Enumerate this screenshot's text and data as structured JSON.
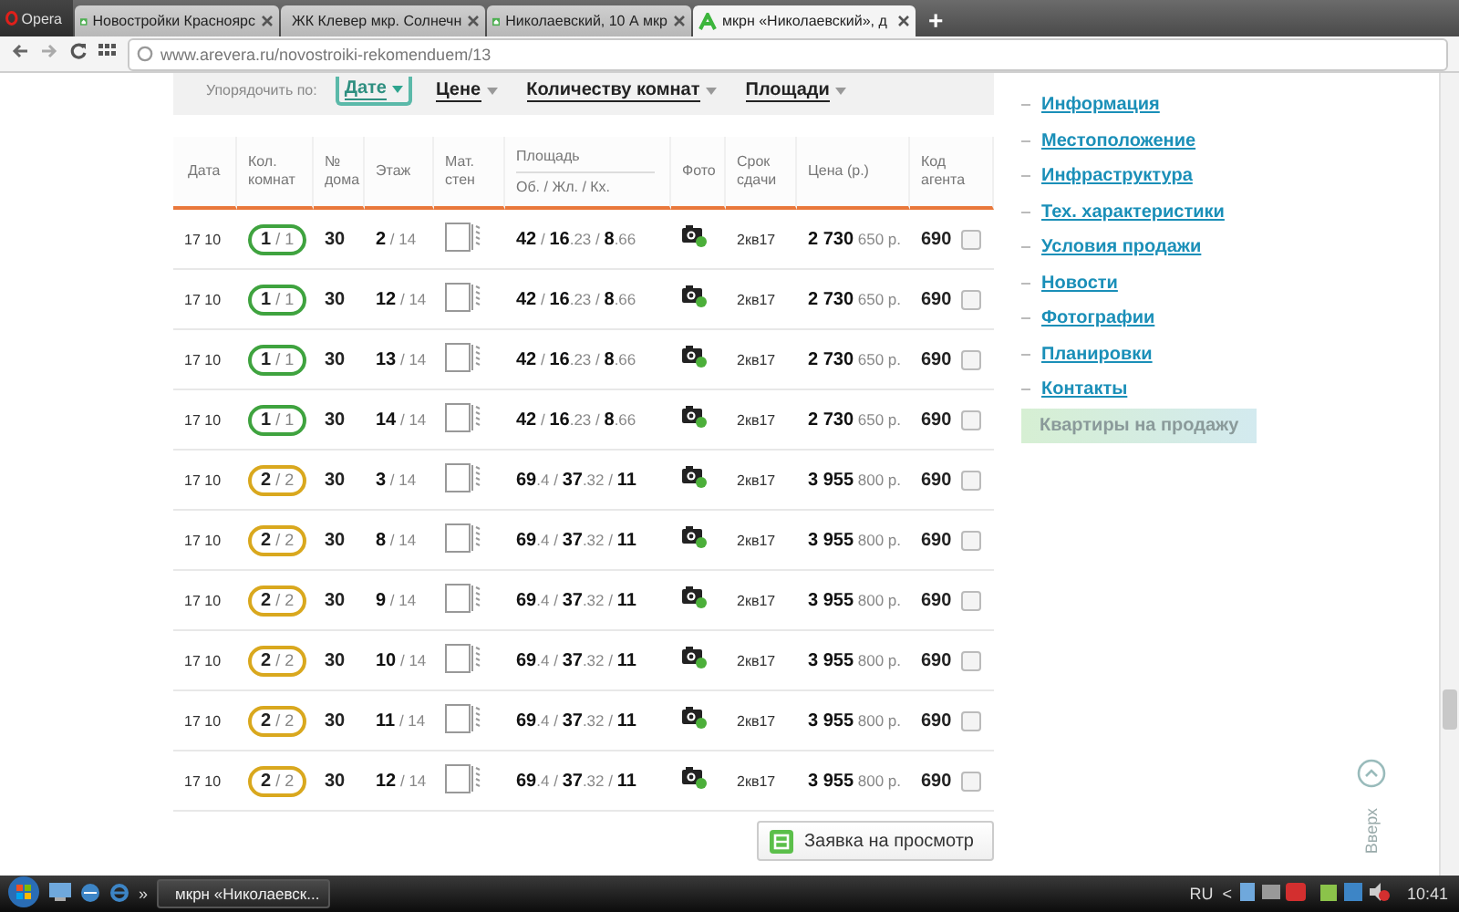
{
  "browser": {
    "menu_label": "Opera",
    "tabs": [
      {
        "title": "Новостройки Красноярс",
        "selected": false
      },
      {
        "title": "ЖК Клевер мкр. Солнечн",
        "selected": false
      },
      {
        "title": "Николаевский, 10 А мкр",
        "selected": false
      },
      {
        "title": "мкрн «Николаевский», д",
        "selected": true
      }
    ],
    "new_tab": "+",
    "url": "www.arevera.ru/novostroiki-rekomenduem/13"
  },
  "sort_bar": {
    "label": "Упорядочить по:",
    "options": [
      {
        "label": "Дате",
        "selected": true
      },
      {
        "label": "Цене",
        "selected": false
      },
      {
        "label": "Количеству комнат",
        "selected": false
      },
      {
        "label": "Площади",
        "selected": false
      }
    ]
  },
  "table": {
    "columns": [
      {
        "label": "Дата"
      },
      {
        "label": "Кол. комнат"
      },
      {
        "label": "№ дома"
      },
      {
        "label": "Этаж"
      },
      {
        "label": "Мат. стен"
      },
      {
        "label": "Площадь",
        "sublabel": "Об. / Жл. / Кх."
      },
      {
        "label": "Фото"
      },
      {
        "label": "Срок сдачи"
      },
      {
        "label": "Цена (р.)"
      },
      {
        "label": "Код агента"
      }
    ],
    "rows": [
      {
        "date": "17 10",
        "rooms": "**1** / 1",
        "color": "#3fa33f",
        "house": "30",
        "floor": "**2** / 14",
        "area": "**42** / **16**.23 / **8**.66",
        "term": "2кв17",
        "price": "**2 730** 650 р.",
        "agent": "690",
        "checked": false
      },
      {
        "date": "17 10",
        "rooms": "**1** / 1",
        "color": "#3fa33f",
        "house": "30",
        "floor": "**12** / 14",
        "area": "**42** / **16**.23 / **8**.66",
        "term": "2кв17",
        "price": "**2 730** 650 р.",
        "agent": "690",
        "checked": false
      },
      {
        "date": "17 10",
        "rooms": "**1** / 1",
        "color": "#3fa33f",
        "house": "30",
        "floor": "**13** / 14",
        "area": "**42** / **16**.23 / **8**.66",
        "term": "2кв17",
        "price": "**2 730** 650 р.",
        "agent": "690",
        "checked": false
      },
      {
        "date": "17 10",
        "rooms": "**1** / 1",
        "color": "#3fa33f",
        "house": "30",
        "floor": "**14** / 14",
        "area": "**42** / **16**.23 / **8**.66",
        "term": "2кв17",
        "price": "**2 730** 650 р.",
        "agent": "690",
        "checked": false
      },
      {
        "date": "17 10",
        "rooms": "**2** / 2",
        "color": "#d9a81e",
        "house": "30",
        "floor": "**3** / 14",
        "area": "**69**.4 / **37**.32 / **11**",
        "term": "2кв17",
        "price": "**3 955** 800 р.",
        "agent": "690",
        "checked": false
      },
      {
        "date": "17 10",
        "rooms": "**2** / 2",
        "color": "#d9a81e",
        "house": "30",
        "floor": "**8** / 14",
        "area": "**69**.4 / **37**.32 / **11**",
        "term": "2кв17",
        "price": "**3 955** 800 р.",
        "agent": "690",
        "checked": false
      },
      {
        "date": "17 10",
        "rooms": "**2** / 2",
        "color": "#d9a81e",
        "house": "30",
        "floor": "**9** / 14",
        "area": "**69**.4 / **37**.32 / **11**",
        "term": "2кв17",
        "price": "**3 955** 800 р.",
        "agent": "690",
        "checked": false
      },
      {
        "date": "17 10",
        "rooms": "**2** / 2",
        "color": "#d9a81e",
        "house": "30",
        "floor": "**10** / 14",
        "area": "**69**.4 / **37**.32 / **11**",
        "term": "2кв17",
        "price": "**3 955** 800 р.",
        "agent": "690",
        "checked": false
      },
      {
        "date": "17 10",
        "rooms": "**2** / 2",
        "color": "#d9a81e",
        "house": "30",
        "floor": "**11** / 14",
        "area": "**69**.4 / **37**.32 / **11**",
        "term": "2кв17",
        "price": "**3 955** 800 р.",
        "agent": "690",
        "checked": false
      },
      {
        "date": "17 10",
        "rooms": "**2** / 2",
        "color": "#d9a81e",
        "house": "30",
        "floor": "**12** / 14",
        "area": "**69**.4 / **37**.32 / **11**",
        "term": "2кв17",
        "price": "**3 955** 800 р.",
        "agent": "690",
        "checked": false
      }
    ]
  },
  "request_button": "Заявка на просмотр",
  "sidebar": {
    "items": [
      {
        "label": "Информация",
        "selected": false
      },
      {
        "label": "Местоположение",
        "selected": false
      },
      {
        "label": "Инфраструктура",
        "selected": false
      },
      {
        "label": "Тех. характеристики",
        "selected": false
      },
      {
        "label": "Условия продажи",
        "selected": false
      },
      {
        "label": "Новости",
        "selected": false
      },
      {
        "label": "Фотографии",
        "selected": false
      },
      {
        "label": "Планировки",
        "selected": false
      },
      {
        "label": "Контакты",
        "selected": false
      },
      {
        "label": "Квартиры на продажу",
        "selected": true
      }
    ]
  },
  "up_link": "Вверх",
  "taskbar": {
    "more": "»",
    "task": "мкрн «Николаевск...",
    "language": "RU",
    "tray_toggle": "<",
    "clock": "10:41"
  }
}
